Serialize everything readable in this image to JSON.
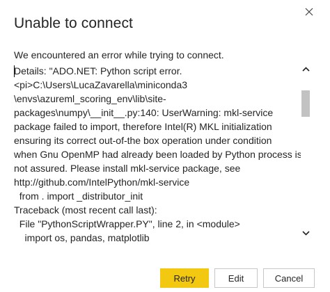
{
  "dialog": {
    "title": "Unable to connect",
    "intro": "We encountered an error while trying to connect.",
    "details_lines": [
      "Details: \"ADO.NET: Python script error.",
      "<pi>C:\\Users\\LucaZavarella\\miniconda3",
      "\\envs\\azureml_scoring_env\\lib\\site-",
      "packages\\numpy\\__init__.py:140: UserWarning: mkl-service",
      "package failed to import, therefore Intel(R) MKL initialization",
      "ensuring its correct out-of-the box operation under condition",
      "when Gnu OpenMP had already been loaded by Python process is",
      "not assured. Please install mkl-service package, see",
      "http://github.com/IntelPython/mkl-service",
      "  from . import _distributor_init",
      "Traceback (most recent call last):",
      "  File \"PythonScriptWrapper.PY\", line 2, in <module>",
      "    import os, pandas, matplotlib"
    ],
    "scroll_position": 0.12,
    "buttons": {
      "retry": "Retry",
      "edit": "Edit",
      "cancel": "Cancel"
    }
  },
  "colors": {
    "primary_button": "#f2c811",
    "text": "#252423",
    "scroll_thumb": "#c2c2c2"
  },
  "icons": {
    "close": "close-icon",
    "scroll_up": "chevron-up-icon",
    "scroll_down": "chevron-down-icon"
  }
}
